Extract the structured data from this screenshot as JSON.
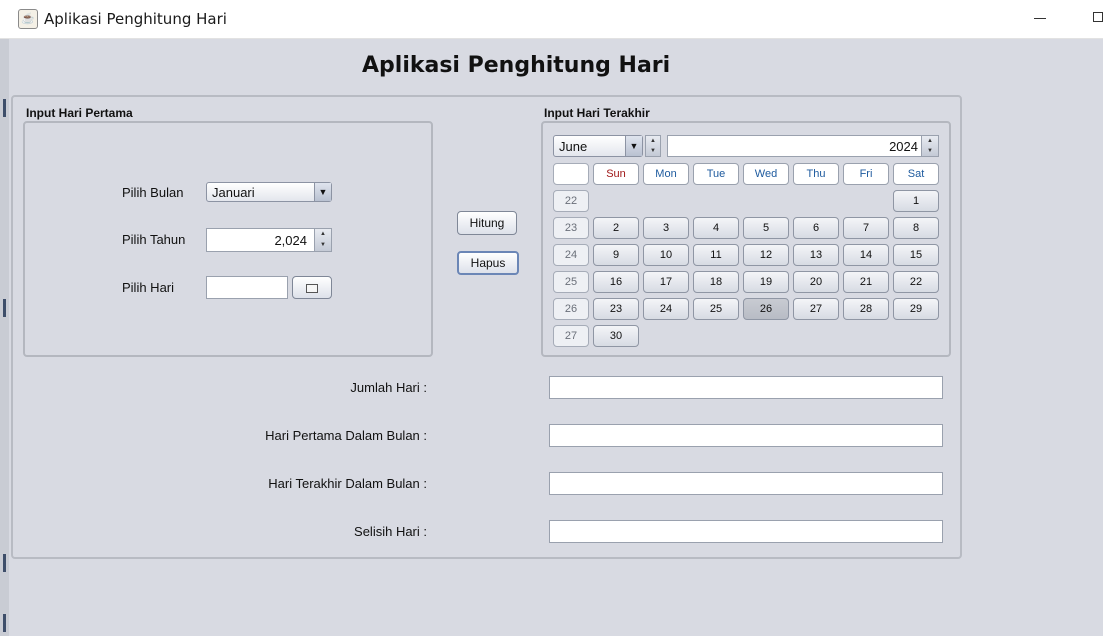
{
  "window": {
    "title": "Aplikasi Penghitung Hari"
  },
  "heading": "Aplikasi Penghitung Hari",
  "first_group": {
    "label": "Input Hari Pertama",
    "month_label": "Pilih Bulan",
    "month_value": "Januari",
    "year_label": "Pilih Tahun",
    "year_value": "2,024",
    "day_label": "Pilih Hari",
    "day_value": ""
  },
  "buttons": {
    "hitung": "Hitung",
    "hapus": "Hapus"
  },
  "last_group": {
    "label": "Input Hari Terakhir",
    "month_value": "June",
    "year_value": "2024",
    "day_headers": [
      {
        "label": "Sun",
        "color": "#a01818"
      },
      {
        "label": "Mon",
        "color": "#1d5a9e"
      },
      {
        "label": "Tue",
        "color": "#1d5a9e"
      },
      {
        "label": "Wed",
        "color": "#1d5a9e"
      },
      {
        "label": "Thu",
        "color": "#1d5a9e"
      },
      {
        "label": "Fri",
        "color": "#1d5a9e"
      },
      {
        "label": "Sat",
        "color": "#1d5a9e"
      }
    ],
    "weeks": [
      {
        "week": "22",
        "days": [
          "",
          "",
          "",
          "",
          "",
          "",
          "1"
        ]
      },
      {
        "week": "23",
        "days": [
          "2",
          "3",
          "4",
          "5",
          "6",
          "7",
          "8"
        ]
      },
      {
        "week": "24",
        "days": [
          "9",
          "10",
          "11",
          "12",
          "13",
          "14",
          "15"
        ]
      },
      {
        "week": "25",
        "days": [
          "16",
          "17",
          "18",
          "19",
          "20",
          "21",
          "22"
        ]
      },
      {
        "week": "26",
        "days": [
          "23",
          "24",
          "25",
          "26",
          "27",
          "28",
          "29"
        ]
      },
      {
        "week": "27",
        "days": [
          "30",
          "",
          "",
          "",
          "",
          "",
          ""
        ]
      }
    ],
    "selected_day": "26"
  },
  "results": [
    {
      "label": "Jumlah Hari :",
      "value": ""
    },
    {
      "label": "Hari Pertama Dalam Bulan :",
      "value": ""
    },
    {
      "label": "Hari Terakhir Dalam Bulan :",
      "value": ""
    },
    {
      "label": "Selisih Hari :",
      "value": ""
    }
  ]
}
